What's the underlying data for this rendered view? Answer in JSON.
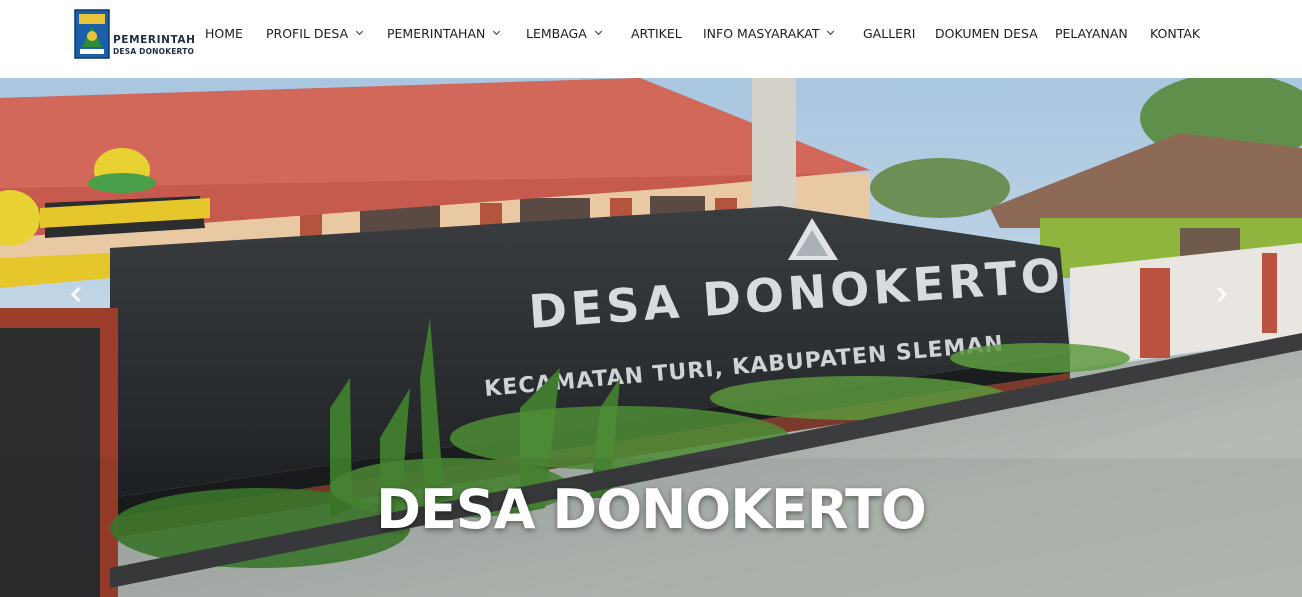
{
  "logo": {
    "line1": "PEMERINTAH",
    "line2": "DESA DONOKERTO",
    "emblem_color": "#1a5fa8"
  },
  "nav": {
    "items": [
      {
        "label": "HOME",
        "has_dropdown": false
      },
      {
        "label": "PROFIL DESA",
        "has_dropdown": true
      },
      {
        "label": "PEMERINTAHAN",
        "has_dropdown": true
      },
      {
        "label": "LEMBAGA",
        "has_dropdown": true
      },
      {
        "label": "ARTIKEL",
        "has_dropdown": false
      },
      {
        "label": "INFO MASYARAKAT",
        "has_dropdown": true
      },
      {
        "label": "GALLERI",
        "has_dropdown": false
      },
      {
        "label": "DOKUMEN DESA",
        "has_dropdown": false
      },
      {
        "label": "PELAYANAN",
        "has_dropdown": false
      },
      {
        "label": "KONTAK",
        "has_dropdown": false
      }
    ]
  },
  "hero": {
    "sign_line1": "DESA DONOKERTO",
    "sign_line2": "KECAMATAN TURI, KABUPATEN SLEMAN",
    "caption": "DESA DONOKERTO",
    "prev_icon": "chevron-left-icon",
    "next_icon": "chevron-right-icon"
  }
}
